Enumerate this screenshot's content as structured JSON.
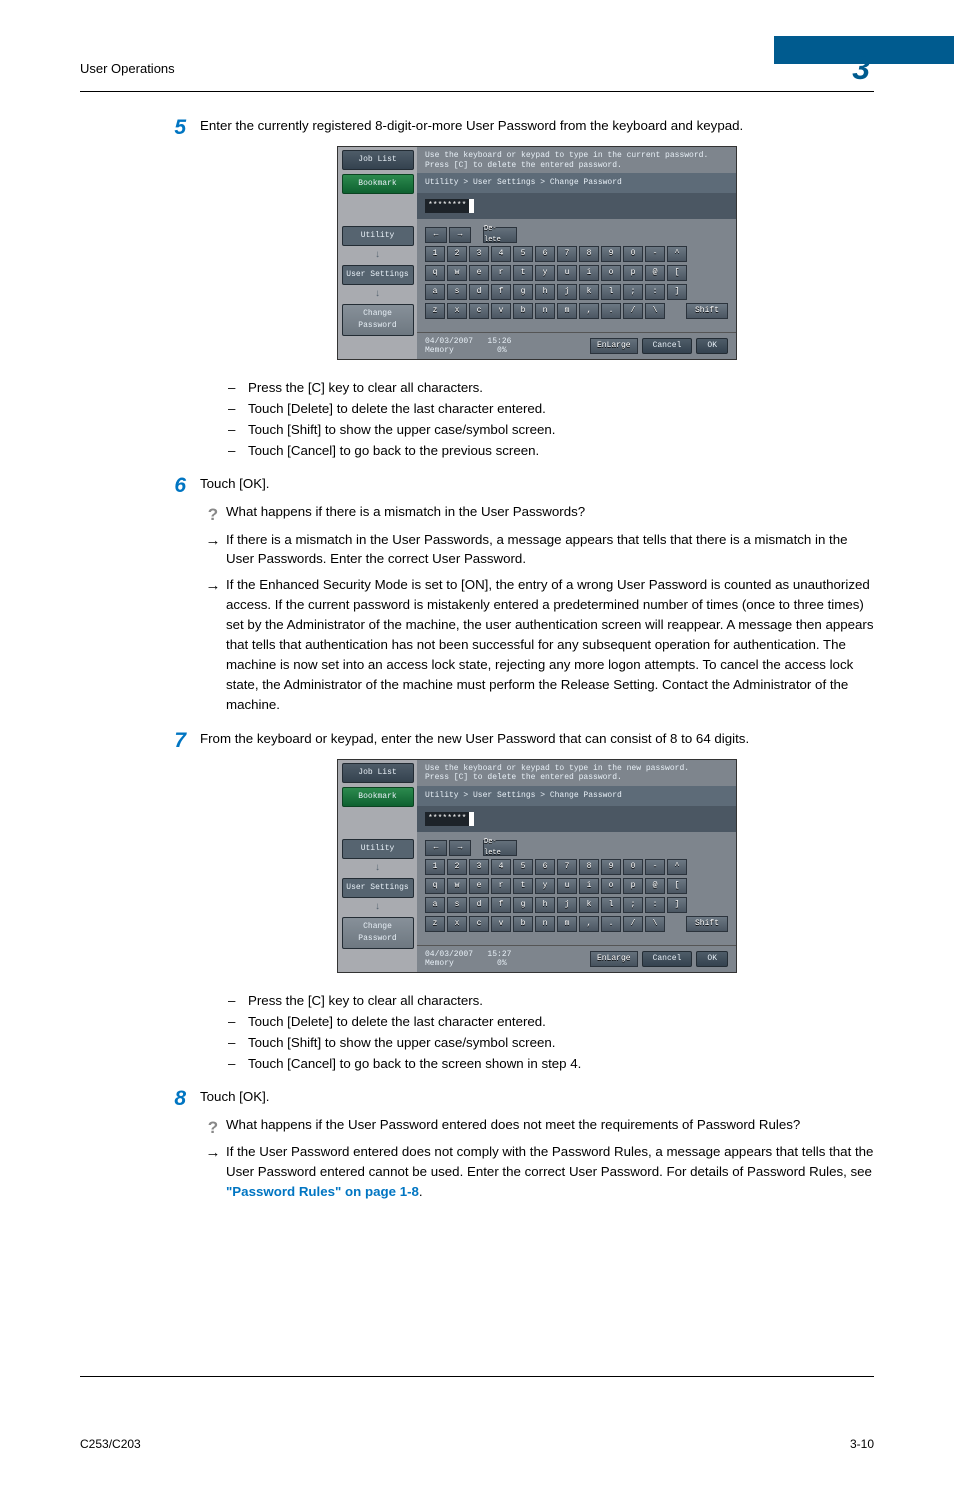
{
  "header": {
    "title": "User Operations",
    "chapter": "3"
  },
  "footer": {
    "model": "C253/C203",
    "page": "3-10"
  },
  "steps": {
    "s5": {
      "num": "5",
      "text": "Enter the currently registered 8-digit-or-more User Password from the keyboard and keypad.",
      "bullets": [
        "Press the [C] key to clear all characters.",
        "Touch [Delete] to delete the last character entered.",
        "Touch [Shift] to show the upper case/symbol screen.",
        "Touch [Cancel] to go back to the previous screen."
      ]
    },
    "s6": {
      "num": "6",
      "text": "Touch [OK].",
      "q": "What happens if there is a mismatch in the User Passwords?",
      "a1": "If there is a mismatch in the User Passwords, a message appears that tells that there is a mismatch in the User Passwords. Enter the correct User Password.",
      "a2": "If the Enhanced Security Mode is set to [ON], the entry of a wrong User Password is counted as unauthorized access. If the current password is mistakenly entered a predetermined number of times (once to three times) set by the Administrator of the machine, the user authentication screen will reappear. A message then appears that tells that authentication has not been successful for any subsequent operation for authentication. The machine is now set into an access lock state, rejecting any more logon attempts. To cancel the access lock state, the Administrator of the machine must perform the Release Setting. Contact the Administrator of the machine."
    },
    "s7": {
      "num": "7",
      "text": "From the keyboard or keypad, enter the new User Password that can consist of 8 to 64 digits.",
      "bullets": [
        "Press the [C] key to clear all characters.",
        "Touch [Delete] to delete the last character entered.",
        "Touch [Shift] to show the upper case/symbol screen.",
        "Touch [Cancel] to go back to the screen shown in step 4."
      ]
    },
    "s8": {
      "num": "8",
      "text": "Touch [OK].",
      "q": "What happens if the User Password entered does not meet the requirements of Password Rules?",
      "a_pre": "If the User Password entered does not comply with the Password Rules, a message appears that tells that the User Password entered cannot be used. Enter the correct User Password. For details of Password Rules, see ",
      "a_link": "\"Password Rules\" on page 1-8",
      "a_post": "."
    }
  },
  "panels": {
    "p1": {
      "instr1": "Use the keyboard or keypad to type in the current password.",
      "instr2": "Press [C] to delete the entered password.",
      "crumb": "Utility > User Settings > Change Password",
      "masked": "********",
      "time": "15:26",
      "date": "04/03/2007",
      "mem": "0%",
      "memlabel": "Memory"
    },
    "p2": {
      "instr1": "Use the keyboard or keypad to type in the new password.",
      "instr2": "Press [C] to delete the entered password.",
      "crumb": "Utility > User Settings > Change Password",
      "masked": "********",
      "time": "15:27",
      "date": "04/03/2007",
      "mem": "0%",
      "memlabel": "Memory"
    },
    "side": {
      "joblist": "Job List",
      "bookmark": "Bookmark",
      "utility": "Utility",
      "usersettings": "User Settings",
      "changepw": "Change Password"
    },
    "keys": {
      "delete": "De-\nlete",
      "shift": "Shift",
      "enlarge": "EnLarge",
      "cancel": "Cancel",
      "ok": "OK",
      "row1": [
        "1",
        "2",
        "3",
        "4",
        "5",
        "6",
        "7",
        "8",
        "9",
        "0",
        "-",
        "^"
      ],
      "row2": [
        "q",
        "w",
        "e",
        "r",
        "t",
        "y",
        "u",
        "i",
        "o",
        "p",
        "@",
        "["
      ],
      "row3": [
        "a",
        "s",
        "d",
        "f",
        "g",
        "h",
        "j",
        "k",
        "l",
        ";",
        ":",
        "]"
      ],
      "row4": [
        "z",
        "x",
        "c",
        "v",
        "b",
        "n",
        "m",
        ",",
        ".",
        "/",
        "\\"
      ]
    }
  }
}
